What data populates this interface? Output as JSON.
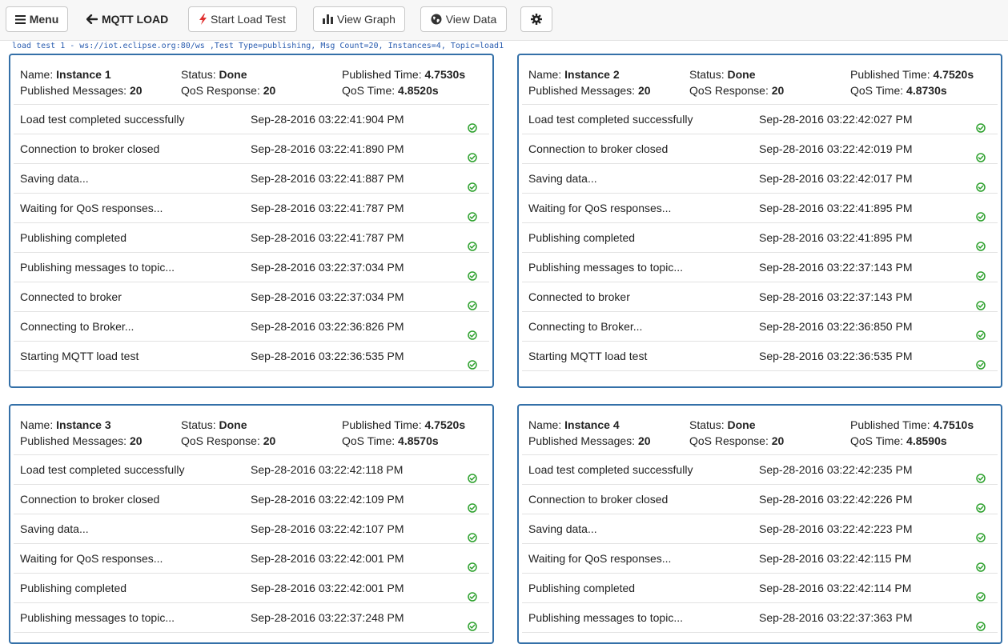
{
  "toolbar": {
    "menu_label": "Menu",
    "brand": "MQTT LOAD",
    "start_label": "Start Load Test",
    "graph_label": "View Graph",
    "data_label": "View Data",
    "icons": {
      "menu": "hamburger-icon",
      "brand": "arrow-left-icon",
      "start": "lightning-icon",
      "graph": "bar-chart-icon",
      "data": "globe-icon",
      "settings": "gear-icon"
    }
  },
  "info_text": "load test 1 - ws://iot.eclipse.org:80/ws ,Test Type=publishing, Msg Count=20, Instances=4, Topic=load1",
  "colors": {
    "panel_border": "#3470a8",
    "check": "#2ca02c",
    "info_text": "#2a5db0",
    "lightning": "#e0302f"
  },
  "labels": {
    "name": "Name:",
    "status": "Status:",
    "published_time": "Published Time:",
    "published_messages": "Published Messages:",
    "qos_response": "QoS Response:",
    "qos_time": "QoS Time:"
  },
  "instances": [
    {
      "name": "Instance 1",
      "status": "Done",
      "published_time": "4.7530s",
      "published_messages": "20",
      "qos_response": "20",
      "qos_time": "4.8520s",
      "events": [
        {
          "message": "Load test completed successfully",
          "time": "Sep-28-2016 03:22:41:904 PM"
        },
        {
          "message": "Connection to broker closed",
          "time": "Sep-28-2016 03:22:41:890 PM"
        },
        {
          "message": "Saving data...",
          "time": "Sep-28-2016 03:22:41:887 PM"
        },
        {
          "message": "Waiting for QoS responses...",
          "time": "Sep-28-2016 03:22:41:787 PM"
        },
        {
          "message": "Publishing completed",
          "time": "Sep-28-2016 03:22:41:787 PM"
        },
        {
          "message": "Publishing messages to topic...",
          "time": "Sep-28-2016 03:22:37:034 PM"
        },
        {
          "message": "Connected to broker",
          "time": "Sep-28-2016 03:22:37:034 PM"
        },
        {
          "message": "Connecting to Broker...",
          "time": "Sep-28-2016 03:22:36:826 PM"
        },
        {
          "message": "Starting MQTT load test",
          "time": "Sep-28-2016 03:22:36:535 PM"
        }
      ]
    },
    {
      "name": "Instance 2",
      "status": "Done",
      "published_time": "4.7520s",
      "published_messages": "20",
      "qos_response": "20",
      "qos_time": "4.8730s",
      "events": [
        {
          "message": "Load test completed successfully",
          "time": "Sep-28-2016 03:22:42:027 PM"
        },
        {
          "message": "Connection to broker closed",
          "time": "Sep-28-2016 03:22:42:019 PM"
        },
        {
          "message": "Saving data...",
          "time": "Sep-28-2016 03:22:42:017 PM"
        },
        {
          "message": "Waiting for QoS responses...",
          "time": "Sep-28-2016 03:22:41:895 PM"
        },
        {
          "message": "Publishing completed",
          "time": "Sep-28-2016 03:22:41:895 PM"
        },
        {
          "message": "Publishing messages to topic...",
          "time": "Sep-28-2016 03:22:37:143 PM"
        },
        {
          "message": "Connected to broker",
          "time": "Sep-28-2016 03:22:37:143 PM"
        },
        {
          "message": "Connecting to Broker...",
          "time": "Sep-28-2016 03:22:36:850 PM"
        },
        {
          "message": "Starting MQTT load test",
          "time": "Sep-28-2016 03:22:36:535 PM"
        }
      ]
    },
    {
      "name": "Instance 3",
      "status": "Done",
      "published_time": "4.7520s",
      "published_messages": "20",
      "qos_response": "20",
      "qos_time": "4.8570s",
      "events": [
        {
          "message": "Load test completed successfully",
          "time": "Sep-28-2016 03:22:42:118 PM"
        },
        {
          "message": "Connection to broker closed",
          "time": "Sep-28-2016 03:22:42:109 PM"
        },
        {
          "message": "Saving data...",
          "time": "Sep-28-2016 03:22:42:107 PM"
        },
        {
          "message": "Waiting for QoS responses...",
          "time": "Sep-28-2016 03:22:42:001 PM"
        },
        {
          "message": "Publishing completed",
          "time": "Sep-28-2016 03:22:42:001 PM"
        },
        {
          "message": "Publishing messages to topic...",
          "time": "Sep-28-2016 03:22:37:248 PM"
        }
      ]
    },
    {
      "name": "Instance 4",
      "status": "Done",
      "published_time": "4.7510s",
      "published_messages": "20",
      "qos_response": "20",
      "qos_time": "4.8590s",
      "events": [
        {
          "message": "Load test completed successfully",
          "time": "Sep-28-2016 03:22:42:235 PM"
        },
        {
          "message": "Connection to broker closed",
          "time": "Sep-28-2016 03:22:42:226 PM"
        },
        {
          "message": "Saving data...",
          "time": "Sep-28-2016 03:22:42:223 PM"
        },
        {
          "message": "Waiting for QoS responses...",
          "time": "Sep-28-2016 03:22:42:115 PM"
        },
        {
          "message": "Publishing completed",
          "time": "Sep-28-2016 03:22:42:114 PM"
        },
        {
          "message": "Publishing messages to topic...",
          "time": "Sep-28-2016 03:22:37:363 PM"
        }
      ]
    }
  ]
}
